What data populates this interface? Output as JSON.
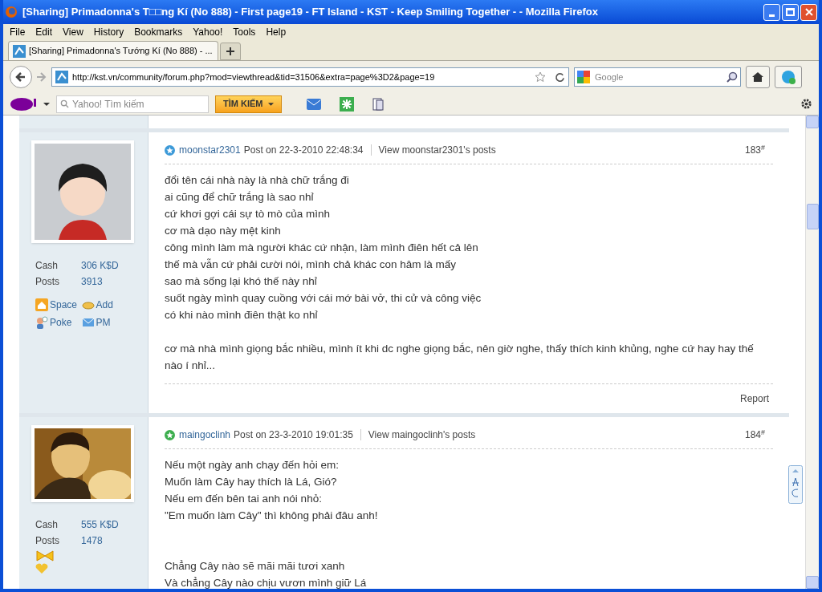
{
  "window": {
    "title": "[Sharing] Primadonna's T□□ng Kí (No 888) - First page19 - FT Island - KST - Keep Smiling Together - - Mozilla Firefox"
  },
  "menu": [
    "File",
    "Edit",
    "View",
    "History",
    "Bookmarks",
    "Yahoo!",
    "Tools",
    "Help"
  ],
  "tabs": [
    {
      "label": "[Sharing] Primadonna's Tướng Kí (No 888) - ...",
      "selected": true
    }
  ],
  "address_bar": {
    "url": "http://kst.vn/community/forum.php?mod=viewthread&tid=31506&extra=page%3D2&page=19"
  },
  "search_bar": {
    "placeholder": "Google"
  },
  "yahoo_toolbar": {
    "search_placeholder": "Yahoo! Tìm kiếm",
    "search_button": "TÌM KIẾM"
  },
  "posts": [
    {
      "author": "moonstar2301",
      "color": "#3d9ad8",
      "posted": "Post on 22-3-2010 22:48:34",
      "view_link": "View moonstar2301's posts",
      "number": "183$^{#}$",
      "avatar": {
        "kind": "cartoon"
      },
      "stats": [
        {
          "label": "Cash",
          "value": "306 K$D"
        },
        {
          "label": "Posts",
          "value": "3913"
        }
      ],
      "actions": [
        {
          "kind": "space",
          "label": "Space"
        },
        {
          "kind": "add",
          "label": "Add"
        },
        {
          "kind": "poke",
          "label": "Poke"
        },
        {
          "kind": "pm",
          "label": "PM"
        }
      ],
      "paragraphs": [
        [
          "đổi tên cái nhà này là nhà chữ trắng đi",
          "ai cũng để chữ trắng là sao nhỉ",
          "cứ khơi gợi cái sự tò mò của mình",
          "cơ mà dạo này mệt kinh",
          "công mình làm mà người khác cứ nhận, làm mình điên hết cả lên",
          "thế mà vẫn cứ phải cười nói, mình chả khác con hâm là mấy",
          "sao mà sống lại khó thế này nhỉ",
          "suốt ngày mình quay cuồng với cái mớ bài vở, thi cử và công việc",
          "có khi nào mình điên thật ko nhỉ"
        ],
        [
          "cơ mà nhà mình giọng bắc nhiều, mình ít khi dc nghe giọng bắc, nên giờ nghe, thấy thích kinh khủng, nghe cứ hay hay thế nào í nhỉ..."
        ]
      ],
      "footer_link": "Report"
    },
    {
      "author": "maingoclinh",
      "color": "#3cae4e",
      "posted": "Post on 23-3-2010 19:01:35",
      "view_link": "View maingoclinh's posts",
      "number": "184$^{#}$",
      "stats": [
        {
          "label": "Cash",
          "value": "555 K$D"
        },
        {
          "label": "Posts",
          "value": "1478"
        }
      ],
      "medals": [
        {
          "kind": "bow"
        },
        {
          "kind": "heart"
        }
      ],
      "paragraphs": [
        [
          "Nếu một ngày anh chạy đến hỏi em:",
          "Muốn làm Cây hay thích là Lá, Gió?",
          "Nếu em đến bên tai anh nói nhỏ:",
          "\"Em muốn làm Cây\" thì không phải đâu anh!"
        ],
        [
          "Chẳng Cây nào sẽ mãi mãi tươi xanh",
          "Và chẳng Cây nào chịu vươn mình giữ Lá"
        ]
      ]
    }
  ]
}
